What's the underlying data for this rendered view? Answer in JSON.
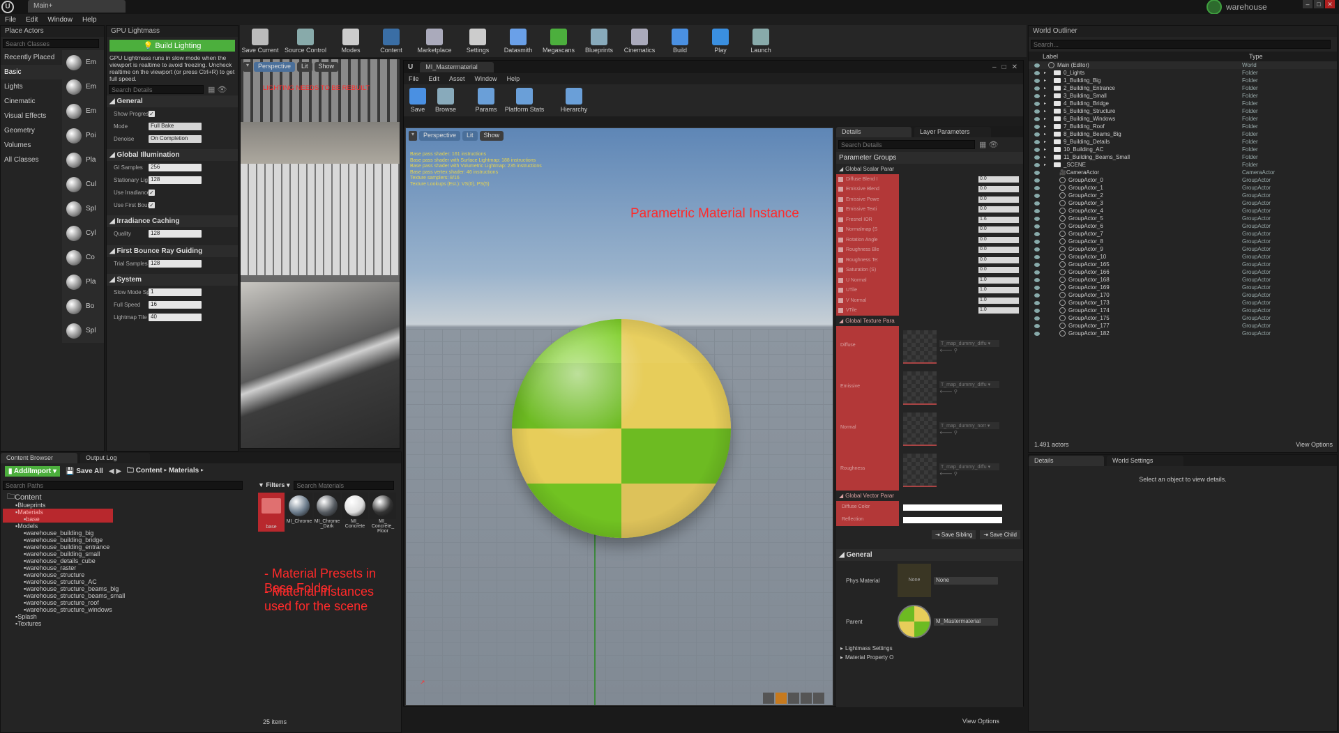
{
  "window": {
    "tab_title": "Main+",
    "profile_name": "warehouse"
  },
  "menu": [
    "File",
    "Edit",
    "Window",
    "Help"
  ],
  "place_actors": {
    "tab": "Place Actors",
    "search_placeholder": "Search Classes",
    "categories": [
      "Recently Placed",
      "Basic",
      "Lights",
      "Cinematic",
      "Visual Effects",
      "Geometry",
      "Volumes",
      "All Classes"
    ],
    "actors": [
      "Em",
      "Em",
      "Em",
      "Poi",
      "Pla",
      "Cul",
      "Spl",
      "Cyl",
      "Co",
      "Pla",
      "Bo",
      "Spl"
    ]
  },
  "lightmass": {
    "tab": "GPU Lightmass",
    "build_label": "Build Lighting",
    "info": "GPU Lightmass runs in slow mode when the viewport is realtime to avoid freezing. Uncheck realtime on the viewport (or press Ctrl+R) to get full speed.",
    "search_placeholder": "Search Details",
    "general": {
      "title": "General",
      "show_progress": "Show Progres",
      "mode_label": "Mode",
      "mode_value": "Full Bake",
      "denoise_label": "Denoise",
      "denoise_value": "On Completion"
    },
    "gi": {
      "title": "Global Illumination",
      "gi_samples_label": "GI Samples",
      "gi_samples": "256",
      "stationary_label": "Stationary Lig",
      "stationary": "128",
      "use_irradiance": "Use Irradiance",
      "use_first": "Use First Bour"
    },
    "irradiance": {
      "title": "Irradiance Caching",
      "quality_label": "Quality",
      "quality": "128"
    },
    "first_bounce": {
      "title": "First Bounce Ray Guiding",
      "trial_label": "Trial Samples",
      "trial": "128"
    },
    "system": {
      "title": "System",
      "slow_label": "Slow Mode Sp",
      "slow": "1",
      "full_label": "Full Speed",
      "full": "16",
      "tile_label": "Lightmap Tile",
      "tile": "40"
    }
  },
  "main_toolbar": [
    "Save Current",
    "Source Control",
    "Modes",
    "Content",
    "Marketplace",
    "Settings",
    "Datasmith",
    "Megascans",
    "Blueprints",
    "Cinematics",
    "Build",
    "Play",
    "Launch"
  ],
  "level_viewport": {
    "perspective": "Perspective",
    "lit": "Lit",
    "show": "Show",
    "warning": "LIGHTING NEEDS TO BE REBUILT"
  },
  "mat_editor": {
    "tab": "MI_Mastermaterial",
    "menu": [
      "File",
      "Edit",
      "Asset",
      "Window",
      "Help"
    ],
    "toolbar": [
      "Save",
      "Browse",
      "Params",
      "Platform Stats",
      "Hierarchy"
    ],
    "viewport": {
      "perspective": "Perspective",
      "lit": "Lit",
      "show": "Show",
      "stats": [
        "Base pass shader: 161 instructions",
        "Base pass shader with Surface Lightmap: 188 instructions",
        "Base pass shader with Volumetric Lightmap: 235 instructions",
        "Base pass vertex shader: 46 instructions",
        "Texture samplers: 8/16",
        "Texture Lookups (Est.): VS(0), PS(5)"
      ],
      "caption": "Parametric Material Instance"
    }
  },
  "mat_details": {
    "tab_details": "Details",
    "tab_layers": "Layer Parameters",
    "search_placeholder": "Search Details",
    "param_groups": "Parameter Groups",
    "scalar_group": "Global Scalar Parar",
    "scalars": [
      {
        "n": "Diffuse Blend I",
        "v": "0.0"
      },
      {
        "n": "Emissive Blend",
        "v": "0.0"
      },
      {
        "n": "Emissive Powe",
        "v": "0.0"
      },
      {
        "n": "Emissive Texti",
        "v": "0.0"
      },
      {
        "n": "Fresnel IOR",
        "v": "1.6"
      },
      {
        "n": "Normalmap (S",
        "v": "0.0"
      },
      {
        "n": "Rotation Angle",
        "v": "0.0"
      },
      {
        "n": "Roughness Ble",
        "v": "0.0"
      },
      {
        "n": "Roughness Te:",
        "v": "0.0"
      },
      {
        "n": "Saturation (S)",
        "v": "0.0"
      },
      {
        "n": "U Normal",
        "v": "1.0"
      },
      {
        "n": "UTile",
        "v": "1.0"
      },
      {
        "n": "V Normal",
        "v": "1.0"
      },
      {
        "n": "VTile",
        "v": "1.0"
      }
    ],
    "texture_group": "Global Texture Para",
    "textures": [
      {
        "n": "Diffuse",
        "t": "T_map_dummy_diffu"
      },
      {
        "n": "Emissive",
        "t": "T_map_dummy_diffu"
      },
      {
        "n": "Normal",
        "t": "T_map_dummy_norr"
      },
      {
        "n": "Roughness",
        "t": "T_map_dummy_diffu"
      }
    ],
    "vector_group": "Global Vector Parar",
    "vectors": [
      "Diffuse Color",
      "Reflection"
    ],
    "save_sibling": "Save Sibling",
    "save_child": "Save Child",
    "general": "General",
    "phys_label": "Phys Material",
    "phys_value": "None",
    "phys_thumb": "None",
    "parent_label": "Parent",
    "parent_value": "M_Mastermaterial",
    "lightmass_settings": "Lightmass Settings",
    "presets": "Material Property O"
  },
  "outliner": {
    "tab": "World Outliner",
    "search_placeholder": "Search...",
    "col_label": "Label",
    "col_type": "Type",
    "rows": [
      {
        "n": "Main (Editor)",
        "t": "World",
        "k": "world"
      },
      {
        "n": "0_Lights",
        "t": "Folder",
        "k": "folder"
      },
      {
        "n": "1_Building_Big",
        "t": "Folder",
        "k": "folder"
      },
      {
        "n": "2_Building_Entrance",
        "t": "Folder",
        "k": "folder"
      },
      {
        "n": "3_Building_Small",
        "t": "Folder",
        "k": "folder"
      },
      {
        "n": "4_Building_Bridge",
        "t": "Folder",
        "k": "folder"
      },
      {
        "n": "5_Building_Structure",
        "t": "Folder",
        "k": "folder"
      },
      {
        "n": "6_Building_Windows",
        "t": "Folder",
        "k": "folder"
      },
      {
        "n": "7_Building_Roof",
        "t": "Folder",
        "k": "folder"
      },
      {
        "n": "8_Building_Beams_Big",
        "t": "Folder",
        "k": "folder"
      },
      {
        "n": "9_Building_Details",
        "t": "Folder",
        "k": "folder"
      },
      {
        "n": "10_Building_AC",
        "t": "Folder",
        "k": "folder"
      },
      {
        "n": "11_Building_Beams_Small",
        "t": "Folder",
        "k": "folder"
      },
      {
        "n": "_SCENE",
        "t": "Folder",
        "k": "folder"
      },
      {
        "n": "CameraActor",
        "t": "CameraActor",
        "k": "cam"
      },
      {
        "n": "GroupActor_0",
        "t": "GroupActor",
        "k": "grp"
      },
      {
        "n": "GroupActor_1",
        "t": "GroupActor",
        "k": "grp"
      },
      {
        "n": "GroupActor_2",
        "t": "GroupActor",
        "k": "grp"
      },
      {
        "n": "GroupActor_3",
        "t": "GroupActor",
        "k": "grp"
      },
      {
        "n": "GroupActor_4",
        "t": "GroupActor",
        "k": "grp"
      },
      {
        "n": "GroupActor_5",
        "t": "GroupActor",
        "k": "grp"
      },
      {
        "n": "GroupActor_6",
        "t": "GroupActor",
        "k": "grp"
      },
      {
        "n": "GroupActor_7",
        "t": "GroupActor",
        "k": "grp"
      },
      {
        "n": "GroupActor_8",
        "t": "GroupActor",
        "k": "grp"
      },
      {
        "n": "GroupActor_9",
        "t": "GroupActor",
        "k": "grp"
      },
      {
        "n": "GroupActor_10",
        "t": "GroupActor",
        "k": "grp"
      },
      {
        "n": "GroupActor_165",
        "t": "GroupActor",
        "k": "grp"
      },
      {
        "n": "GroupActor_166",
        "t": "GroupActor",
        "k": "grp"
      },
      {
        "n": "GroupActor_168",
        "t": "GroupActor",
        "k": "grp"
      },
      {
        "n": "GroupActor_169",
        "t": "GroupActor",
        "k": "grp"
      },
      {
        "n": "GroupActor_170",
        "t": "GroupActor",
        "k": "grp"
      },
      {
        "n": "GroupActor_173",
        "t": "GroupActor",
        "k": "grp"
      },
      {
        "n": "GroupActor_174",
        "t": "GroupActor",
        "k": "grp"
      },
      {
        "n": "GroupActor_175",
        "t": "GroupActor",
        "k": "grp"
      },
      {
        "n": "GroupActor_177",
        "t": "GroupActor",
        "k": "grp"
      },
      {
        "n": "GroupActor_182",
        "t": "GroupActor",
        "k": "grp"
      }
    ],
    "count": "1.491 actors",
    "view_options": "View Options"
  },
  "world_details": {
    "tab_details": "Details",
    "tab_world": "World Settings",
    "empty": "Select an object to view details."
  },
  "content_browser": {
    "tab": "Content Browser",
    "tab_log": "Output Log",
    "add_import": "Add/Import",
    "save_all": "Save All",
    "crumbs": [
      "Content",
      "Materials"
    ],
    "search_paths": "Search Paths",
    "filters": "Filters",
    "search_materials": "Search Materials",
    "tree": [
      {
        "n": "Content",
        "lvl": 0
      },
      {
        "n": "Blueprints",
        "lvl": 1
      },
      {
        "n": "Materials",
        "lvl": 1,
        "sel": true
      },
      {
        "n": "base",
        "lvl": 2,
        "sel": true
      },
      {
        "n": "Models",
        "lvl": 1
      },
      {
        "n": "warehouse_building_big",
        "lvl": 2
      },
      {
        "n": "warehouse_building_bridge",
        "lvl": 2
      },
      {
        "n": "warehouse_building_entrance",
        "lvl": 2
      },
      {
        "n": "warehouse_building_small",
        "lvl": 2
      },
      {
        "n": "warehouse_details_cube",
        "lvl": 2
      },
      {
        "n": "warehouse_raster",
        "lvl": 2
      },
      {
        "n": "warehouse_structure",
        "lvl": 2
      },
      {
        "n": "warehouse_structure_AC",
        "lvl": 2
      },
      {
        "n": "warehouse_structure_beams_big",
        "lvl": 2
      },
      {
        "n": "warehouse_structure_beams_small",
        "lvl": 2
      },
      {
        "n": "warehouse_structure_roof",
        "lvl": 2
      },
      {
        "n": "warehouse_structure_windows",
        "lvl": 2
      },
      {
        "n": "Splash",
        "lvl": 1
      },
      {
        "n": "Textures",
        "lvl": 1
      }
    ],
    "assets": [
      "base",
      "MI_Chrome",
      "MI_Chrome _Dark",
      "MI_ Concrete",
      "MI_ Concrete_ Floor"
    ],
    "notes": [
      "- Material Presets in Base Folder",
      "- Material Instances used for the scene"
    ],
    "count": "25 items",
    "view_options": "View Options"
  },
  "colors": {
    "accent_green": "#4caf3d",
    "red": "#ff2a2a",
    "sel_blue": "#3a6ea5"
  }
}
